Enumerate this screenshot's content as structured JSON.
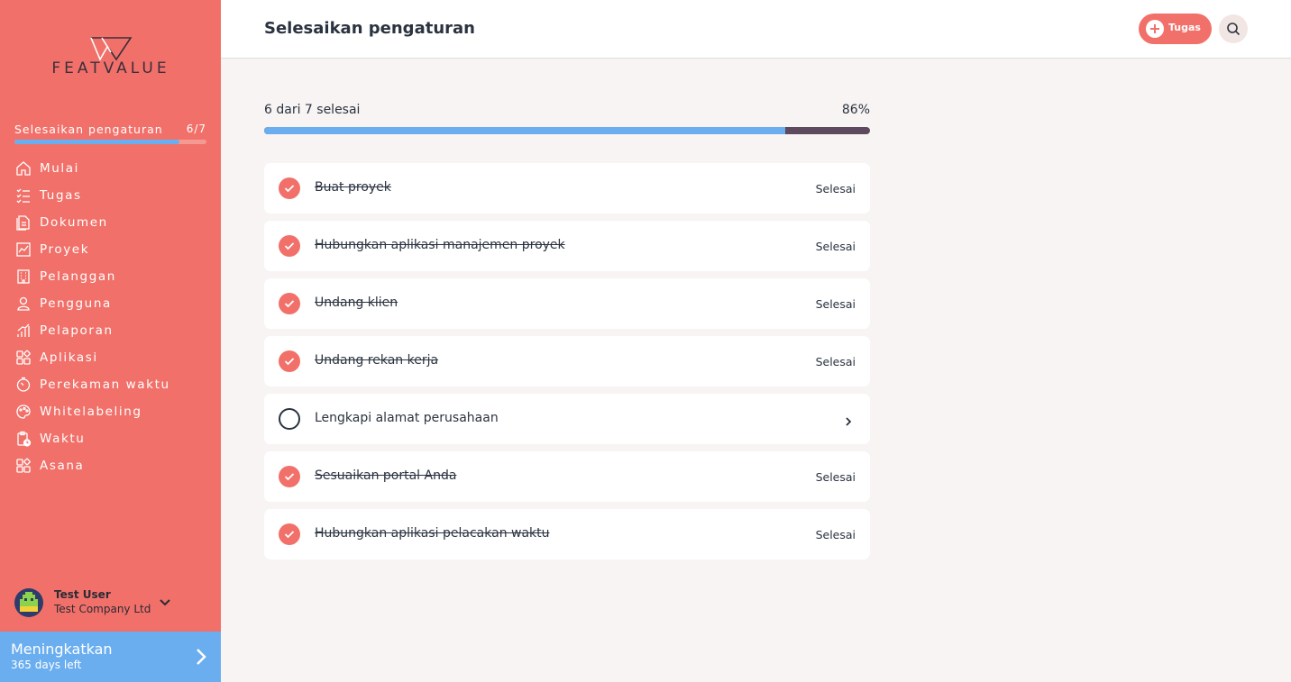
{
  "sidebar": {
    "logo_text": "FEATVALUE",
    "setup": {
      "label": "Selesaikan pengaturan",
      "count": "6/7",
      "progress": 0.857
    },
    "items": [
      {
        "label": "Mulai",
        "icon": "home-icon"
      },
      {
        "label": "Tugas",
        "icon": "tasks-icon"
      },
      {
        "label": "Dokumen",
        "icon": "document-icon"
      },
      {
        "label": "Proyek",
        "icon": "project-icon"
      },
      {
        "label": "Pelanggan",
        "icon": "building-icon"
      },
      {
        "label": "Pengguna",
        "icon": "user-icon"
      },
      {
        "label": "Pelaporan",
        "icon": "reporting-icon"
      },
      {
        "label": "Aplikasi",
        "icon": "apps-icon"
      },
      {
        "label": "Perekaman waktu",
        "icon": "timer-icon"
      },
      {
        "label": "Whitelabeling",
        "icon": "palette-icon"
      },
      {
        "label": "Waktu",
        "icon": "clipboard-clock-icon"
      },
      {
        "label": "Asana",
        "icon": "apps-icon"
      }
    ],
    "user": {
      "name": "Test User",
      "company": "Test Company Ltd"
    },
    "upgrade": {
      "title": "Meningkatkan",
      "subtitle": "365 days left"
    }
  },
  "header": {
    "title": "Selesaikan pengaturan",
    "task_button": "Tugas",
    "accent": "#f1716a"
  },
  "progress": {
    "text": "6 dari 7 selesai",
    "percent_label": "86%",
    "value": 0.86
  },
  "tasks": [
    {
      "name": "Buat proyek",
      "done": true,
      "status": "Selesai"
    },
    {
      "name": "Hubungkan aplikasi manajemen proyek",
      "done": true,
      "status": "Selesai"
    },
    {
      "name": "Undang klien",
      "done": true,
      "status": "Selesai"
    },
    {
      "name": "Undang rekan kerja",
      "done": true,
      "status": "Selesai"
    },
    {
      "name": "Lengkapi alamat perusahaan",
      "done": false,
      "status": ""
    },
    {
      "name": "Sesuaikan portal Anda",
      "done": true,
      "status": "Selesai"
    },
    {
      "name": "Hubungkan aplikasi pelacakan waktu",
      "done": true,
      "status": "Selesai"
    }
  ],
  "colors": {
    "sidebar": "#f1716a",
    "progress_fill": "#6aaef0",
    "progress_track": "#5d4a5f",
    "upgrade": "#6aaef0"
  }
}
